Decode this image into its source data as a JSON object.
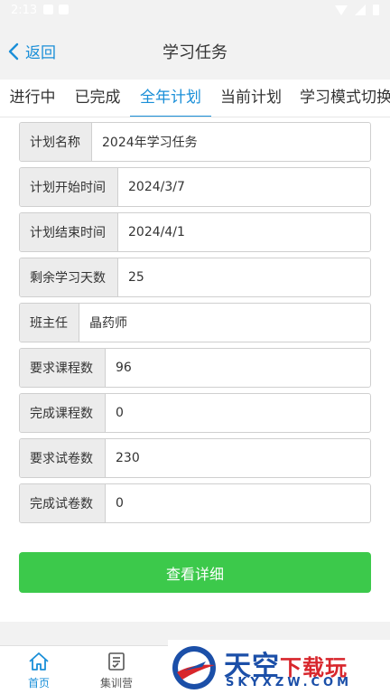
{
  "status_bar": {
    "time": "2:13"
  },
  "nav": {
    "back_label": "返回",
    "title": "学习任务"
  },
  "tabs": [
    {
      "label": "进行中",
      "active": false
    },
    {
      "label": "已完成",
      "active": false
    },
    {
      "label": "全年计划",
      "active": true
    },
    {
      "label": "当前计划",
      "active": false
    },
    {
      "label": "学习模式切换",
      "active": false
    }
  ],
  "fields": [
    {
      "label": "计划名称",
      "value": "2024年学习任务"
    },
    {
      "label": "计划开始时间",
      "value": "2024/3/7"
    },
    {
      "label": "计划结束时间",
      "value": "2024/4/1"
    },
    {
      "label": "剩余学习天数",
      "value": "25"
    },
    {
      "label": "班主任",
      "value": "晶药师"
    },
    {
      "label": "要求课程数",
      "value": "96"
    },
    {
      "label": "完成课程数",
      "value": "0"
    },
    {
      "label": "要求试卷数",
      "value": "230"
    },
    {
      "label": "完成试卷数",
      "value": "0"
    }
  ],
  "detail_button": {
    "label": "查看详细"
  },
  "bottom_nav": [
    {
      "label": "首页",
      "icon": "home-icon",
      "active": true
    },
    {
      "label": "集训营",
      "icon": "clipboard-icon",
      "active": false
    }
  ],
  "watermark": {
    "main_blue": "天空",
    "main_red": "下载玩",
    "sub": "SKYXZW.COM"
  },
  "colors": {
    "accent": "#1a8fd8",
    "button_green": "#3cc94b",
    "label_bg": "#ececec"
  }
}
